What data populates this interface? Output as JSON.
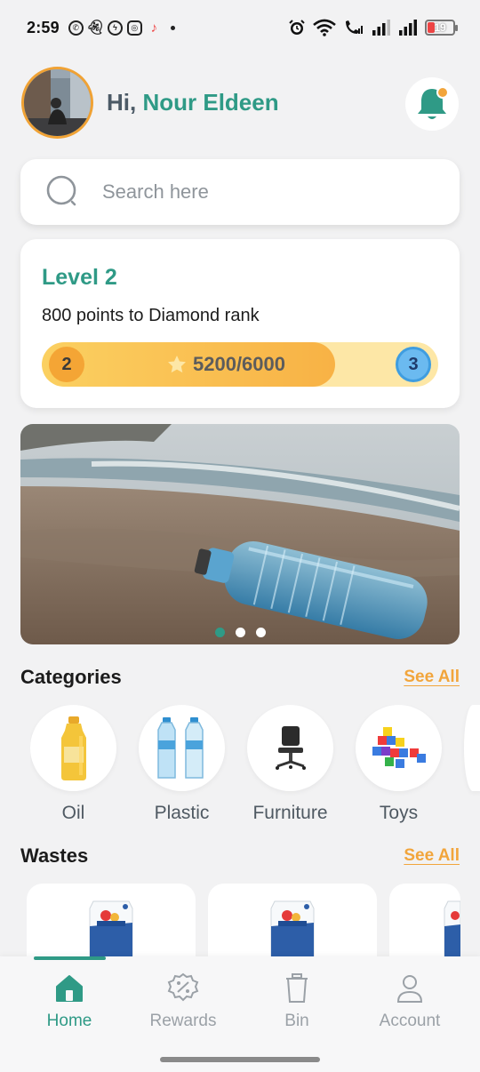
{
  "status_bar": {
    "time": "2:59",
    "battery": "19",
    "app_icons": [
      "whatsapp-icon",
      "snapchat-icon",
      "messenger-icon",
      "instagram-icon",
      "tiktok-icon"
    ]
  },
  "header": {
    "greeting": "Hi,",
    "user_name": "Nour Eldeen"
  },
  "search": {
    "placeholder": "Search here"
  },
  "level": {
    "title": "Level 2",
    "subtitle": "800 points to Diamond rank",
    "current_level": "2",
    "next_level": "3",
    "points_text": "5200/6000",
    "progress": 0.74
  },
  "banner": {
    "slides": 3,
    "active_slide": 0
  },
  "categories": {
    "title": "Categories",
    "see_all": "See All",
    "items": [
      {
        "label": "Oil",
        "icon": "oil-bottle-icon"
      },
      {
        "label": "Plastic",
        "icon": "plastic-bottles-icon"
      },
      {
        "label": "Furniture",
        "icon": "office-chair-icon"
      },
      {
        "label": "Toys",
        "icon": "toy-blocks-icon"
      }
    ]
  },
  "wastes": {
    "title": "Wastes",
    "see_all": "See All"
  },
  "nav": {
    "items": [
      {
        "label": "Home",
        "icon": "home-icon",
        "active": true
      },
      {
        "label": "Rewards",
        "icon": "discount-badge-icon",
        "active": false
      },
      {
        "label": "Bin",
        "icon": "trash-bin-icon",
        "active": false
      },
      {
        "label": "Account",
        "icon": "user-icon",
        "active": false
      }
    ]
  },
  "colors": {
    "brand_green": "#2f9a86",
    "accent_orange": "#f2a53b",
    "background": "#f2f2f3"
  }
}
